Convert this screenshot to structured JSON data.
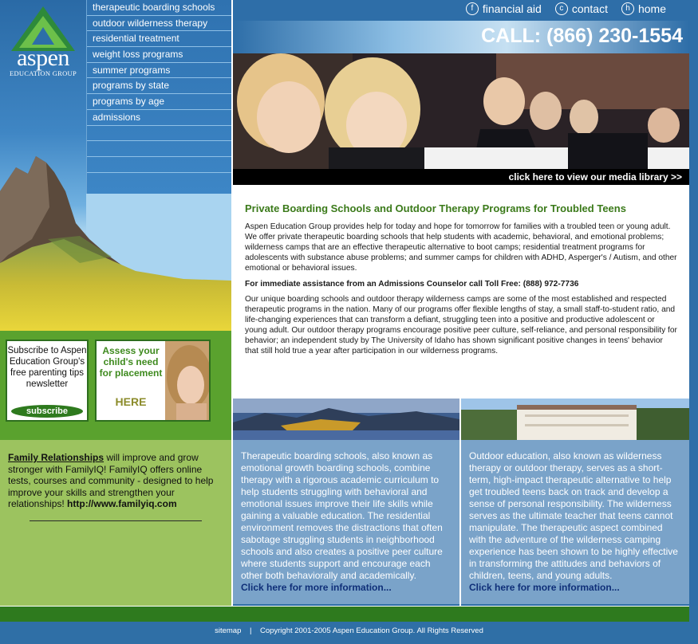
{
  "logo": {
    "name": "aspen",
    "sub": "EDUCATION GROUP"
  },
  "nav": {
    "items": [
      {
        "label": "therapeutic boarding schools"
      },
      {
        "label": "outdoor wilderness therapy"
      },
      {
        "label": "residential treatment"
      },
      {
        "label": "weight loss programs"
      },
      {
        "label": "summer programs"
      },
      {
        "label": "programs by state"
      },
      {
        "label": "programs by age"
      },
      {
        "label": "admissions"
      }
    ]
  },
  "top_links": [
    {
      "icon": "f",
      "label": "financial aid"
    },
    {
      "icon": "c",
      "label": "contact"
    },
    {
      "icon": "h",
      "label": "home"
    }
  ],
  "call": "CALL: (866) 230-1554",
  "media_link": "click here to view our media library >>",
  "main": {
    "title": "Private Boarding Schools and Outdoor Therapy Programs for Troubled Teens",
    "para1": "Aspen Education Group provides help for today and hope for tomorrow for families with a troubled teen or young adult. We offer private therapeutic boarding schools that help students with academic, behavioral, and emotional problems; wilderness camps that are an effective therapeutic alternative to boot camps; residential treatment programs for adolescents with substance abuse problems; and summer camps for children with ADHD, Asperger's / Autism, and other emotional or behavioral issues.",
    "assist": "For immediate assistance from an Admissions Counselor call Toll Free: (888) 972-7736",
    "para2": "Our unique boarding schools and outdoor therapy wilderness camps are some of the most established and respected therapeutic programs in the nation. Many of our programs offer flexible lengths of stay, a small staff-to-student ratio, and life-changing experiences that can transform a defiant, struggling teen into a positive and productive adolescent or young adult. Our outdoor therapy programs encourage positive peer culture, self-reliance, and personal responsibility for behavior; an independent study by The University of Idaho has shown significant positive changes in teens' behavior that still hold true a year after participation in our wilderness programs."
  },
  "subscribe": {
    "text": "Subscribe to Aspen Education Group's free parenting tips newsletter",
    "button": "subscribe"
  },
  "assess": {
    "text": "Assess your child's need for placement",
    "here": "HERE"
  },
  "family": {
    "link": "Family Relationships",
    "text": " will improve and grow stronger with FamilyIQ! FamilyIQ offers online tests, courses and community - designed to help improve your skills and strengthen your relationships!  ",
    "url": "http://www.familyiq.com"
  },
  "panel_left": {
    "text": "Therapeutic boarding schools, also known as emotional growth boarding schools, combine therapy with a rigorous academic curriculum to help students struggling with behavioral and emotional issues improve their life skills while gaining a valuable education. The residential environment removes the distractions that often sabotage struggling students in neighborhood schools and also creates a positive peer culture where students support and encourage each other both behaviorally and academically.",
    "more": "Click here for more information..."
  },
  "panel_right": {
    "text": "Outdoor education, also known as wilderness therapy or outdoor therapy, serves as a short-term, high-impact therapeutic alternative to help get troubled teens back on track and develop a sense of personal responsibility. The wilderness serves as the ultimate teacher that teens cannot manipulate. The therapeutic aspect combined with the adventure of the wilderness camping experience has been shown to be highly effective in transforming the attitudes and behaviors of children, teens, and young adults.",
    "more": "Click here for more information..."
  },
  "footer": {
    "sitemap": "sitemap",
    "sep": "|",
    "copyright": "Copyright 2001-2005 Aspen Education Group. All Rights Reserved"
  }
}
